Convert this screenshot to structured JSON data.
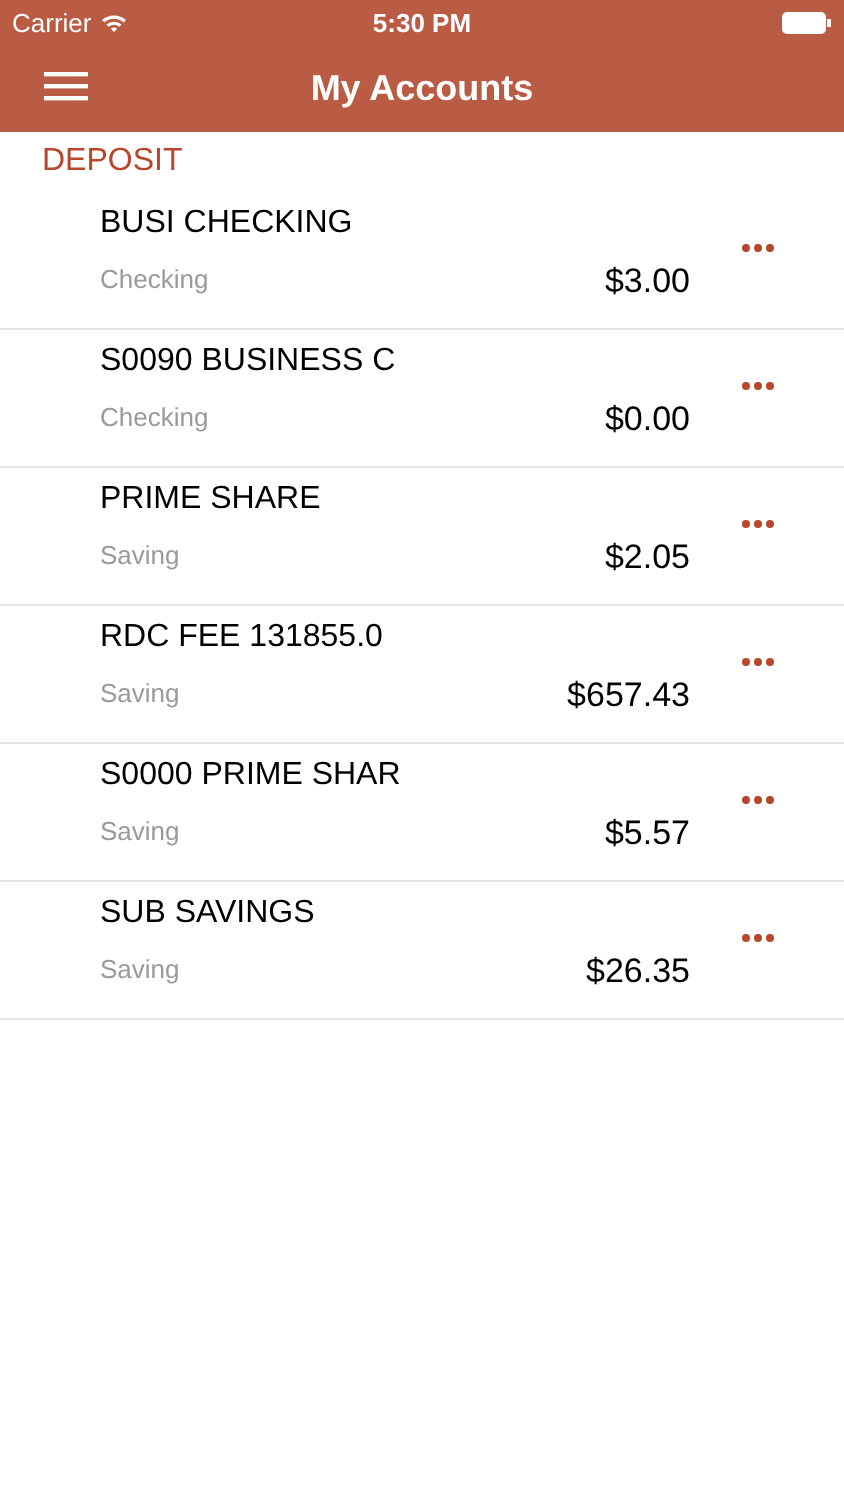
{
  "status_bar": {
    "carrier": "Carrier",
    "time": "5:30 PM"
  },
  "nav_bar": {
    "title": "My Accounts"
  },
  "section": {
    "title": "DEPOSIT"
  },
  "accounts": [
    {
      "name": "BUSI CHECKING",
      "type": "Checking",
      "balance": "$3.00"
    },
    {
      "name": "S0090 BUSINESS C",
      "type": "Checking",
      "balance": "$0.00"
    },
    {
      "name": "PRIME SHARE",
      "type": "Saving",
      "balance": "$2.05"
    },
    {
      "name": "RDC FEE 131855.0",
      "type": "Saving",
      "balance": "$657.43"
    },
    {
      "name": "S0000 PRIME SHAR",
      "type": "Saving",
      "balance": "$5.57"
    },
    {
      "name": "SUB SAVINGS",
      "type": "Saving",
      "balance": "$26.35"
    }
  ]
}
